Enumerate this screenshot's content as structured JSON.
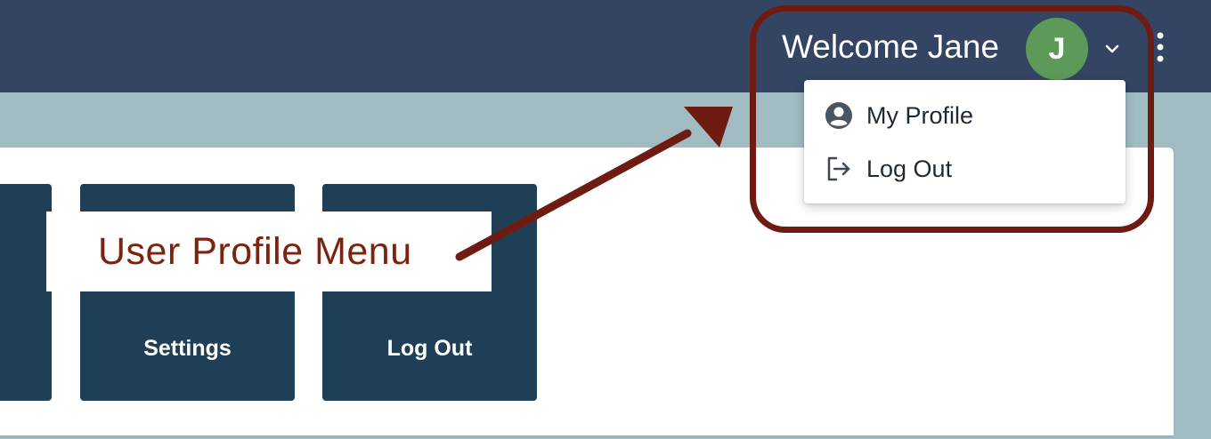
{
  "header": {
    "welcome_text": "Welcome Jane",
    "avatar_initial": "J",
    "avatar_color": "#5d9a5a",
    "chevron_icon": "chevron-down-icon",
    "more_icon": "vertical-dots-icon",
    "background_color": "#344563"
  },
  "user_menu": {
    "items": [
      {
        "label": "My Profile",
        "icon": "user-circle-icon"
      },
      {
        "label": "Log Out",
        "icon": "sign-out-icon"
      }
    ]
  },
  "tiles": [
    {
      "label": ""
    },
    {
      "label": "Settings"
    },
    {
      "label": "Log Out"
    }
  ],
  "annotation": {
    "label": "User Profile Menu",
    "color": "#6e1c12"
  }
}
